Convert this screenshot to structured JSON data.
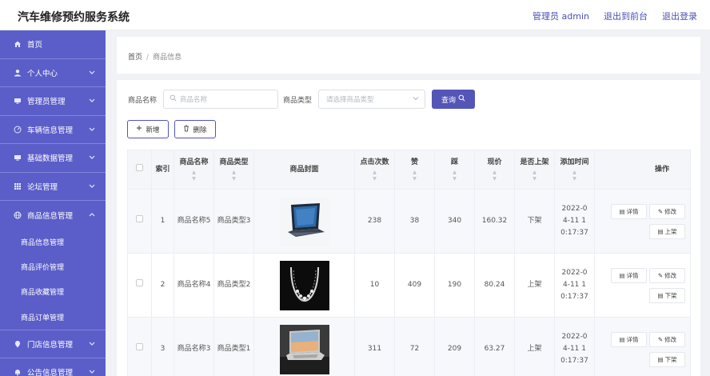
{
  "header": {
    "title": "汽车维修预约服务系统",
    "admin_label": "管理员 admin",
    "front_link": "退出到前台",
    "logout_link": "退出登录"
  },
  "sidebar": {
    "items": [
      {
        "label": "首页",
        "icon": "home-icon",
        "expandable": false
      },
      {
        "label": "个人中心",
        "icon": "user-icon",
        "expandable": true
      },
      {
        "label": "管理员管理",
        "icon": "monitor-icon",
        "expandable": true
      },
      {
        "label": "车辆信息管理",
        "icon": "gauge-icon",
        "expandable": true
      },
      {
        "label": "基础数据管理",
        "icon": "monitor-icon",
        "expandable": true
      },
      {
        "label": "论坛管理",
        "icon": "grid-icon",
        "expandable": true
      },
      {
        "label": "商品信息管理",
        "icon": "globe-icon",
        "expandable": true,
        "open": true
      },
      {
        "label": "门店信息管理",
        "icon": "pin-icon",
        "expandable": true
      },
      {
        "label": "公告信息管理",
        "icon": "bell-icon",
        "expandable": true
      }
    ],
    "submenu": [
      "商品信息管理",
      "商品评价管理",
      "商品收藏管理",
      "商品订单管理"
    ]
  },
  "breadcrumb": {
    "home": "首页",
    "current": "商品信息"
  },
  "search": {
    "name_label": "商品名称",
    "name_placeholder": "商品名称",
    "type_label": "商品类型",
    "type_placeholder": "请选择商品类型",
    "query_label": "查询"
  },
  "actions": {
    "add_label": "新增",
    "delete_label": "删除"
  },
  "table": {
    "headers": {
      "index": "索引",
      "name": "商品名称",
      "type": "商品类型",
      "cover": "商品封面",
      "clicks": "点击次数",
      "likes": "赞",
      "dislikes": "踩",
      "price": "现价",
      "on_sale": "是否上架",
      "added": "添加时间",
      "ops": "操作"
    },
    "rows": [
      {
        "index": "1",
        "name": "商品名称5",
        "type": "商品类型3",
        "cover": "laptop",
        "clicks": "238",
        "likes": "38",
        "dislikes": "340",
        "price": "160.32",
        "on_sale": "下架",
        "added": "2022-04-11 10:17:37",
        "op_detail": "详情",
        "op_edit": "修改",
        "op_toggle": "上架"
      },
      {
        "index": "2",
        "name": "商品名称4",
        "type": "商品类型2",
        "cover": "necklace",
        "clicks": "10",
        "likes": "409",
        "dislikes": "190",
        "price": "80.24",
        "on_sale": "上架",
        "added": "2022-04-11 10:17:37",
        "op_detail": "详情",
        "op_edit": "修改",
        "op_toggle": "下架"
      },
      {
        "index": "3",
        "name": "商品名称3",
        "type": "商品类型1",
        "cover": "laptop-open",
        "clicks": "311",
        "likes": "72",
        "dislikes": "209",
        "price": "63.27",
        "on_sale": "上架",
        "added": "2022-04-11 10:17:37",
        "op_detail": "详情",
        "op_edit": "修改",
        "op_toggle": "下架"
      }
    ]
  },
  "colors": {
    "sidebar": "#5b5ec8",
    "accent": "#5355b7"
  }
}
